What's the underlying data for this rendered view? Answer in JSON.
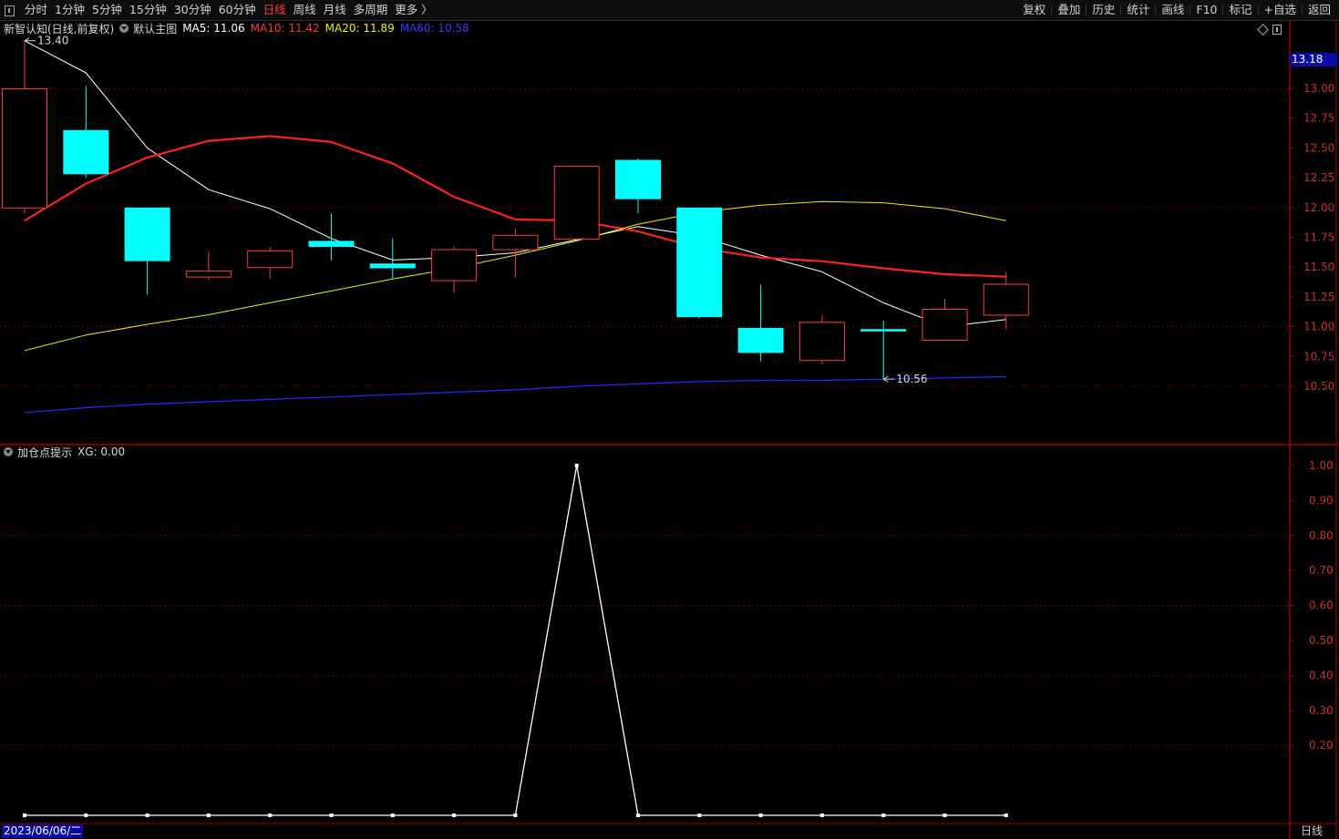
{
  "toolbar": {
    "periods": [
      "分时",
      "1分钟",
      "5分钟",
      "15分钟",
      "30分钟",
      "60分钟",
      "日线",
      "周线",
      "月线",
      "多周期",
      "更多 〉"
    ],
    "active_period": "日线",
    "actions": [
      "复权",
      "叠加",
      "历史",
      "统计",
      "画线",
      "F10",
      "标记",
      "+自选",
      "返回"
    ]
  },
  "main_legend": {
    "title": "新智认知(日线,前复权)",
    "template": "默认主图",
    "ma5": "MA5: 11.06",
    "ma10": "MA10: 11.42",
    "ma20": "MA20: 11.89",
    "ma60": "MA60: 10.58"
  },
  "indicator_legend": {
    "title": "加仓点提示",
    "value": "XG: 0.00"
  },
  "colors": {
    "up": "#ff3b3b",
    "down": "#00ffff",
    "ma5": "#ffffff",
    "ma10": "#ff2020",
    "ma20": "#f0f000",
    "ma60": "#2828ff",
    "axis": "#9b0000"
  },
  "status": {
    "date": "2023/06/06/二",
    "period": "日线"
  },
  "chart_data": [
    {
      "type": "candlestick",
      "ylim": [
        10.0,
        13.5
      ],
      "y_ticks": [
        "13.00",
        "12.75",
        "12.50",
        "12.25",
        "12.00",
        "11.75",
        "11.50",
        "11.25",
        "11.00",
        "10.75",
        "10.50"
      ],
      "y_tick_values": [
        13.0,
        12.75,
        12.5,
        12.25,
        12.0,
        11.75,
        11.5,
        11.25,
        11.0,
        10.75,
        10.5
      ],
      "current_price": "13.18",
      "current_price_value": 13.18,
      "annotations": [
        {
          "text": "13.40",
          "index": 0,
          "value": 13.4
        },
        {
          "text": "10.56",
          "index": 14,
          "value": 10.56
        }
      ],
      "candles": [
        {
          "o": 12.0,
          "h": 13.4,
          "l": 11.95,
          "c": 13.0
        },
        {
          "o": 12.65,
          "h": 13.02,
          "l": 12.25,
          "c": 12.28
        },
        {
          "o": 12.0,
          "h": 12.0,
          "l": 11.27,
          "c": 11.55
        },
        {
          "o": 11.42,
          "h": 11.63,
          "l": 11.39,
          "c": 11.47
        },
        {
          "o": 11.5,
          "h": 11.67,
          "l": 11.4,
          "c": 11.64
        },
        {
          "o": 11.72,
          "h": 11.95,
          "l": 11.56,
          "c": 11.67
        },
        {
          "o": 11.53,
          "h": 11.74,
          "l": 11.4,
          "c": 11.49
        },
        {
          "o": 11.39,
          "h": 11.67,
          "l": 11.28,
          "c": 11.65
        },
        {
          "o": 11.65,
          "h": 11.82,
          "l": 11.41,
          "c": 11.77
        },
        {
          "o": 11.74,
          "h": 12.35,
          "l": 11.73,
          "c": 12.35
        },
        {
          "o": 12.4,
          "h": 12.41,
          "l": 11.95,
          "c": 12.07
        },
        {
          "o": 12.0,
          "h": 12.0,
          "l": 11.07,
          "c": 11.08
        },
        {
          "o": 10.99,
          "h": 11.35,
          "l": 10.71,
          "c": 10.78
        },
        {
          "o": 10.72,
          "h": 11.1,
          "l": 10.68,
          "c": 11.04
        },
        {
          "o": 10.98,
          "h": 11.05,
          "l": 10.56,
          "c": 10.96
        },
        {
          "o": 10.89,
          "h": 11.23,
          "l": 10.88,
          "c": 11.15
        },
        {
          "o": 11.1,
          "h": 11.46,
          "l": 10.98,
          "c": 11.36
        }
      ],
      "series": [
        {
          "name": "MA5",
          "values": [
            13.4,
            13.13,
            12.5,
            12.15,
            11.99,
            11.74,
            11.56,
            11.58,
            11.62,
            11.73,
            11.84,
            11.76,
            11.6,
            11.46,
            11.2,
            11.0,
            11.06
          ]
        },
        {
          "name": "MA10",
          "values": [
            11.89,
            12.2,
            12.42,
            12.56,
            12.6,
            12.55,
            12.37,
            12.09,
            11.9,
            11.89,
            11.8,
            11.66,
            11.58,
            11.55,
            11.49,
            11.44,
            11.42
          ]
        },
        {
          "name": "MA20",
          "values": [
            10.8,
            10.93,
            11.02,
            11.1,
            11.2,
            11.3,
            11.4,
            11.49,
            11.6,
            11.72,
            11.86,
            11.96,
            12.02,
            12.05,
            12.04,
            11.99,
            11.89
          ]
        },
        {
          "name": "MA60",
          "values": [
            10.28,
            10.32,
            10.35,
            10.37,
            10.39,
            10.41,
            10.43,
            10.45,
            10.47,
            10.5,
            10.52,
            10.54,
            10.55,
            10.55,
            10.56,
            10.57,
            10.58
          ]
        }
      ]
    },
    {
      "type": "line",
      "name": "XG",
      "ylim": [
        0,
        1.0
      ],
      "y_ticks": [
        "1.00",
        "0.90",
        "0.80",
        "0.70",
        "0.60",
        "0.50",
        "0.40",
        "0.30",
        "0.20"
      ],
      "y_tick_values": [
        1.0,
        0.9,
        0.8,
        0.7,
        0.6,
        0.5,
        0.4,
        0.3,
        0.2
      ],
      "values": [
        0,
        0,
        0,
        0,
        0,
        0,
        0,
        0,
        0,
        1,
        0,
        0,
        0,
        0,
        0,
        0,
        0
      ]
    }
  ]
}
